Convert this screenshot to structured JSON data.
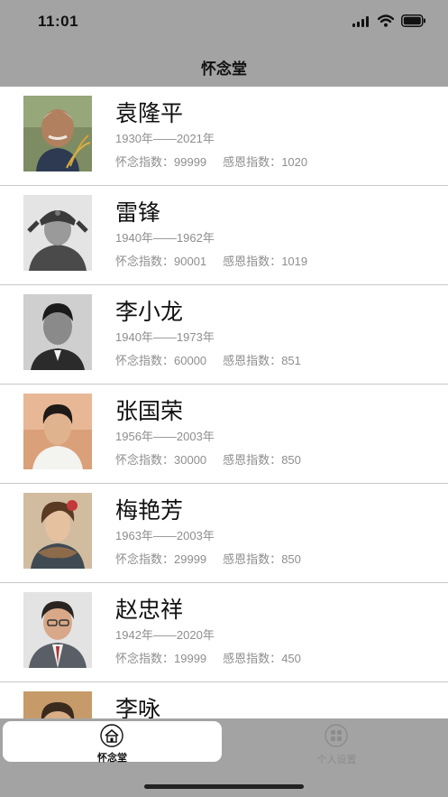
{
  "status_bar": {
    "time": "11:01"
  },
  "nav": {
    "title": "怀念堂"
  },
  "list": [
    {
      "name": "袁隆平",
      "years": "1930年——2021年",
      "miss_label": "怀念指数：",
      "miss_value": "99999",
      "thanks_label": "感恩指数：",
      "thanks_value": "1020",
      "photo": "person-photo-yuan-longping"
    },
    {
      "name": "雷锋",
      "years": "1940年——1962年",
      "miss_label": "怀念指数：",
      "miss_value": "90001",
      "thanks_label": "感恩指数：",
      "thanks_value": "1019",
      "photo": "person-photo-lei-feng"
    },
    {
      "name": "李小龙",
      "years": "1940年——1973年",
      "miss_label": "怀念指数：",
      "miss_value": "60000",
      "thanks_label": "感恩指数：",
      "thanks_value": "851",
      "photo": "person-photo-bruce-lee"
    },
    {
      "name": "张国荣",
      "years": "1956年——2003年",
      "miss_label": "怀念指数：",
      "miss_value": "30000",
      "thanks_label": "感恩指数：",
      "thanks_value": "850",
      "photo": "person-photo-leslie-cheung"
    },
    {
      "name": "梅艳芳",
      "years": "1963年——2003年",
      "miss_label": "怀念指数：",
      "miss_value": "29999",
      "thanks_label": "感恩指数：",
      "thanks_value": "850",
      "photo": "person-photo-anita-mui"
    },
    {
      "name": "赵忠祥",
      "years": "1942年——2020年",
      "miss_label": "怀念指数：",
      "miss_value": "19999",
      "thanks_label": "感恩指数：",
      "thanks_value": "450",
      "photo": "person-photo-zhao-zhongxiang"
    },
    {
      "name": "李咏",
      "years": "",
      "miss_label": "",
      "miss_value": "",
      "thanks_label": "",
      "thanks_value": "",
      "photo": "person-photo-li-yong"
    }
  ],
  "tabs": [
    {
      "label": "怀念堂",
      "icon": "memorial-hall-icon",
      "active": true
    },
    {
      "label": "个人设置",
      "icon": "settings-grid-icon",
      "active": false
    }
  ],
  "colors": {
    "bar_background": "#a3a3a3",
    "list_background": "#ffffff",
    "secondary_text": "#8e8e8e",
    "separator": "#c8c8c8"
  }
}
